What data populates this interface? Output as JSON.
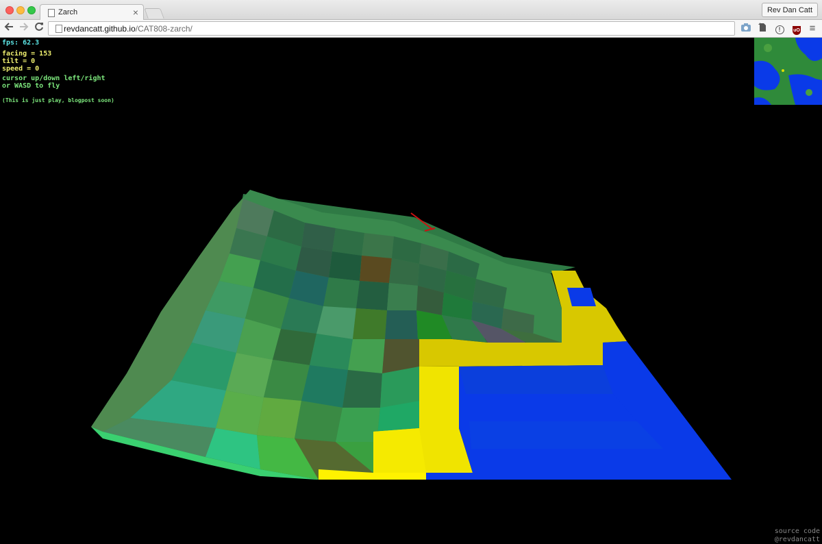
{
  "browser": {
    "tab_title": "Zarch",
    "tab_close": "×",
    "profile_name": "Rev Dan Catt",
    "url_host": "revdancatt.github.io",
    "url_path": "/CAT808-zarch/"
  },
  "hud": {
    "fps": "fps: 62.3",
    "facing": "facing = 153",
    "tilt": "tilt = 0",
    "speed": "speed = 0",
    "help_line1": "cursor up/down left/right",
    "help_line2": "or WASD to fly",
    "note": "(This is just play, blogpost soon)"
  },
  "footer": {
    "source_code": "source code",
    "author": "@revdancatt"
  },
  "icons": [
    "document-icon",
    "back-arrow-icon",
    "forward-arrow-icon",
    "reload-icon",
    "camera-icon",
    "evernote-icon",
    "info-icon",
    "ublock-icon",
    "hamburger-menu-icon",
    "ship-icon"
  ],
  "colors": {
    "background": "#000000",
    "land_green": "#3f9a55",
    "sand_yellow": "#e6d600",
    "water_blue": "#0a3ae8",
    "ship_red": "#cc1111"
  }
}
